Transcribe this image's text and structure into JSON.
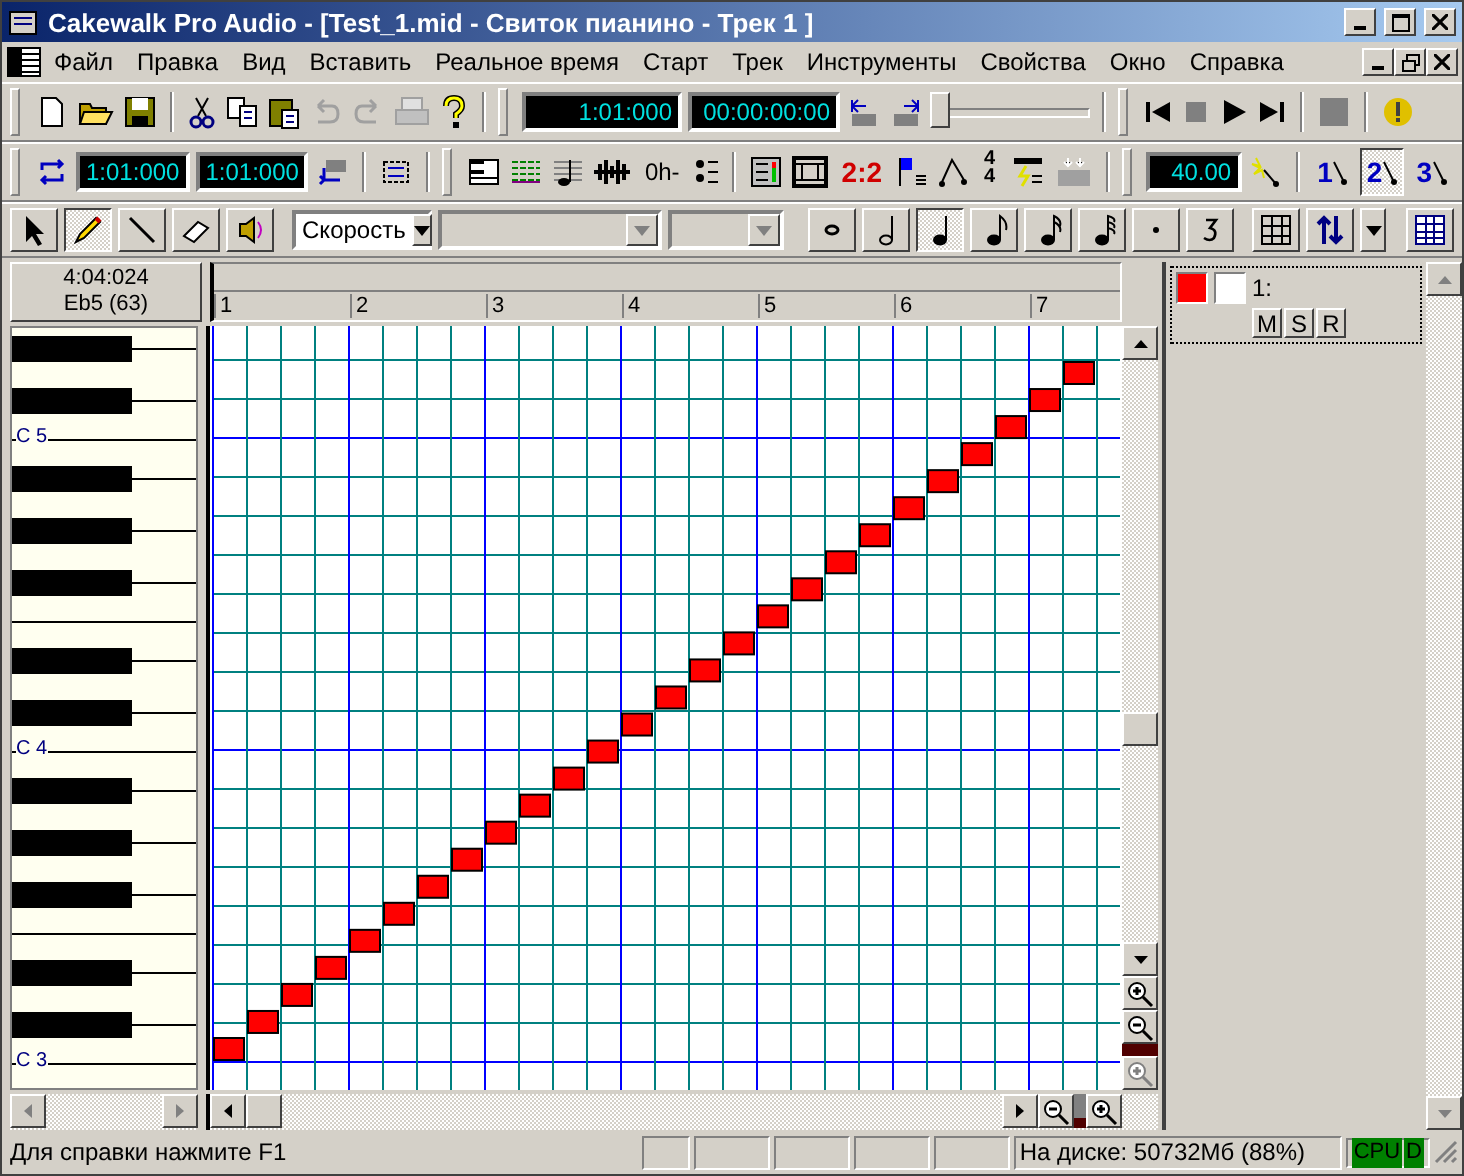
{
  "window": {
    "title": "Cakewalk Pro Audio - [Test_1.mid - Свиток пианино - Трек 1 ]"
  },
  "menu": [
    "Файл",
    "Правка",
    "Вид",
    "Вставить",
    "Реальное время",
    "Старт",
    "Трек",
    "Инструменты",
    "Свойства",
    "Окно",
    "Справка"
  ],
  "transport": {
    "now_time": "1:01:000",
    "smpte": "00:00:00:00",
    "position": {
      "level": 0
    }
  },
  "loop": {
    "start": "1:01:000",
    "end": "1:01:000"
  },
  "view_bar": {
    "meter_button": "2:2",
    "time_signature": [
      "4",
      "4"
    ],
    "lyrics_button": "0h-"
  },
  "tempo": {
    "value": "40.00",
    "ratios": [
      {
        "label": "1",
        "selected": false
      },
      {
        "label": "2",
        "selected": true
      },
      {
        "label": "3",
        "selected": false
      }
    ]
  },
  "tools": [
    {
      "kind": "select",
      "selected": false
    },
    {
      "kind": "draw",
      "selected": true
    },
    {
      "kind": "line",
      "selected": false
    },
    {
      "kind": "erase",
      "selected": false
    },
    {
      "kind": "scrub",
      "selected": false
    }
  ],
  "controller": {
    "value": "Скорость"
  },
  "durations": [
    {
      "kind": "whole",
      "selected": false
    },
    {
      "kind": "half",
      "selected": false
    },
    {
      "kind": "quarter",
      "selected": true
    },
    {
      "kind": "eighth",
      "selected": false
    },
    {
      "kind": "sixteenth",
      "selected": false
    },
    {
      "kind": "thirty_second",
      "selected": false
    },
    {
      "kind": "dot",
      "selected": false
    },
    {
      "kind": "triplet",
      "selected": false
    }
  ],
  "snap_grid": {
    "selected": false
  },
  "cursor": {
    "time": "4:04:024",
    "pitch": "Eb5 (63)"
  },
  "ruler": [
    "1",
    "2",
    "3",
    "4",
    "5",
    "6",
    "7"
  ],
  "keyboard_labels": [
    "C 5",
    "C 4",
    "C 3"
  ],
  "track": {
    "number": "1:",
    "buttons": [
      "M",
      "S",
      "R"
    ]
  },
  "status_bar": {
    "hint": "Для справки нажмите F1",
    "disk": "На диске: 50732Мб (88%)",
    "cpu_meter": "CPU",
    "disk_meter": "D"
  }
}
